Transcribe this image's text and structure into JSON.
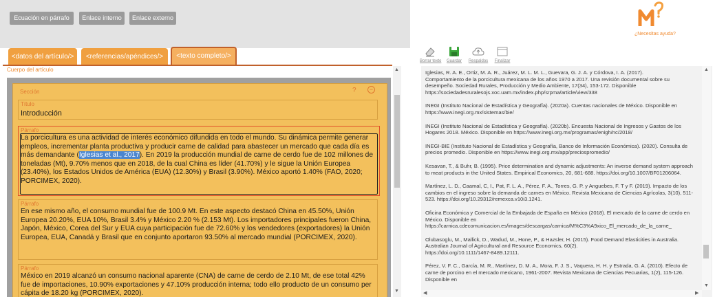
{
  "toolbar_left": {
    "btn_equation": "Ecuación en párrafo",
    "btn_internal_link": "Enlace interno",
    "btn_external_link": "Enlace externo"
  },
  "tabs": [
    {
      "label": "<datos del artículo/>"
    },
    {
      "label": "<referencias/apéndices/>"
    },
    {
      "label": "<texto completo/>"
    }
  ],
  "body_label": "Cuerpo del artículo",
  "section": {
    "label": "Sección",
    "help_icon": "?",
    "collapse_icon": "−",
    "title_label": "Título",
    "title_value": "Introducción",
    "paragraph_label": "Párrafo",
    "p1_before": "La porcicultura es una actividad de interés económico difundida en todo el mundo. Su dinámica permite generar empleos, incrementar planta productiva y producir carne de calidad para abastecer un mercado que cada día es más demandante (",
    "p1_highlight": "Iglesias et al., 2017",
    "p1_after": "). En 2019 la producción mundial de carne de cerdo fue de 102 millones de toneladas (Mt), 9.70% menos que en 2018, de la cual China es líder (41.70%) y le sigue la Unión Europea (23.40%), los Estados Unidos de América (EUA) (12.30%) y Brasil (3.90%). México aportó 1.40% (FAO, 2020; PORCIMEX, 2020).",
    "p2": "En ese mismo año, el consumo mundial fue de 100.9 Mt. En este aspecto destacó China en 45.50%, Unión Europea 20.20%, EUA 10%, Brasil 3.4% y México 2.20 % (2.153 Mt). Los importadores principales fueron China, Japón, México, Corea del Sur y EUA cuya participación fue de 72.60% y los vendedores (exportadores) la Unión Europea, EUA, Canadá y Brasil que en conjunto aportaron 93.50% al mercado mundial (PORCIMEX, 2020).",
    "p3": "México en 2019 alcanzó un consumo nacional aparente (CNA) de carne de cerdo de 2.10 Mt, de ese total 42% fue de importaciones, 10.90% exportaciones y 47.10% producción interna; todo ello producto de un consumo per cápita de 18.20 kg (PORCIMEX, 2020)."
  },
  "help_link": "¿Necesitas ayuda?",
  "toolbar_right": {
    "erase": "Borrar texto",
    "save": "Guardar",
    "backups": "Respaldos",
    "finish": "Finalizar"
  },
  "colors": {
    "accent": "#f0a040",
    "tab_active_border": "#c0602a",
    "section_bg": "#f3c05c",
    "highlight": "#4b86d0"
  },
  "references": [
    "Iglesias, R. A. E., Ortiz, M. A. R., Juárez, M. L. M. L., Guevara, G. J. A. y Córdova, I. A. (2017).\nComportamiento de la porcicultura mexicana de los años 1970 a 2017. Una revisión documental sobre su desempeño. Sociedad Rurales, Producción y Medio Ambiente, 17(34), 153-172. Disponible https://sociedadesruralesojs.xoc.uam.mx/index.php/srpma/article/view/338",
    "INEGI (Instituto Nacional de Estadística y Geografía). (2020a). Cuentas nacionales de México. Disponible en https://www.inegi.org.mx/sistemas/bie/",
    "INEGI (Instituto Nacional de Estadística y Geografía). (2020b). Encuesta Nacional de Ingresos y Gastos de los Hogares 2018. México. Disponible en https://www.inegi.org.mx/programas/enigh/nc/2018/",
    "INEGI-BIE (Instituto Nacional de Estadística y Geografía, Banco de Información Económica). (2020). Consulta de precios promedio. Disponible en https://www.inegi.org.mx/app/preciospromedio/",
    "Kesavan, T., & Buhr, B. (1995). Price determination and dynamic adjustments: An inverse demand system approach to meat products in the United States. Empirical Economics, 20, 681-688. https://doi.org/10.1007/BF01206064.",
    "Martínez, L. D., Caamal, C, I., Pat, F. L. A., Pérez, F. A., Torres, G. P. y Anguebes, F. T y F. (2019). Impacto de los cambios en el ingreso sobre la demanda de carnes en México. Revista Mexicana de Ciencias Agrícolas, 3(10), 511-523. https://doi.org/10.29312/remexca.v10i3.1241.",
    "Oficina Económica y Comercial de la Embajada de España en México (2018). El mercado de la carne de cerdo en México. Disponible en\nhttps://carnica.cdecomunicacion.es/images/descargas/carnica/M%C3%A9xico_El_mercado_de_la_carne_",
    "Olubasoglu, M., Mallick, D., Wadud, M., Hone, P., & Hazsler, H. (2015). Food Demand Elasticities in Australia. Australian Journal of Agricultural and Resource Economics, 60(2).\nhttps://doi.org/10.1111/1467-8489.12111.",
    "Pérez, V. F. C., García, M. R., Martínez, D. M. A., Mora, F. J. S., Vaquera, H. H. y Estrada, G. A. (2010). Efecto de carne de porcino en el mercado mexicano, 1961-2007. Revista Mexicana de Ciencias Pecuarias, 1(2), 115-126. Disponible en"
  ]
}
